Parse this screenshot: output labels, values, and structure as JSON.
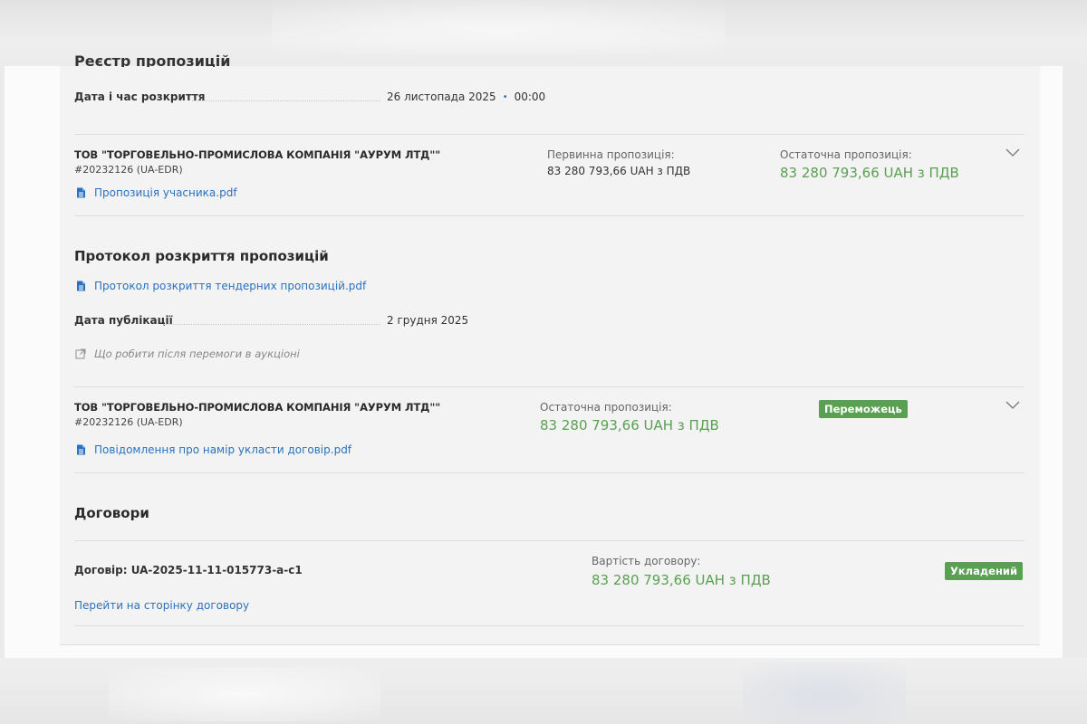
{
  "bids_registry": {
    "heading": "Реєстр пропозицій",
    "opening_label": "Дата і час розкриття",
    "opening_date": "26 листопада 2025",
    "opening_separator": "•",
    "opening_time": "00:00"
  },
  "bid": {
    "company": "ТОВ \"ТОРГОВЕЛЬНО-ПРОМИСЛОВА КОМПАНІЯ \"АУРУМ ЛТД\"\"",
    "edr": "#20232126 (UA-EDR)",
    "document": "Пропозиція учасника.pdf",
    "initial_label": "Первинна пропозиція:",
    "initial_value": "83 280 793,66 UAH з ПДВ",
    "final_label": "Остаточна пропозиція:",
    "final_value": "83 280 793,66 UAH з ПДВ"
  },
  "protocol": {
    "title": "Протокол розкриття пропозицій",
    "document": "Протокол розкриття тендерних пропозицій.pdf",
    "publication_label": "Дата публікації",
    "publication_date": "2 грудня 2025",
    "help_link": "Що робити після перемоги в аукціоні"
  },
  "winner": {
    "company": "ТОВ \"ТОРГОВЕЛЬНО-ПРОМИСЛОВА КОМПАНІЯ \"АУРУМ ЛТД\"\"",
    "edr": "#20232126 (UA-EDR)",
    "document": "Повідомлення про намір укласти договір.pdf",
    "final_label": "Остаточна пропозиція:",
    "final_value": "83 280 793,66 UAH з ПДВ",
    "badge": "Переможець"
  },
  "contracts": {
    "title": "Договори",
    "contract_label": "Договір: UA-2025-11-11-015773-a-c1",
    "value_label": "Вартість договору:",
    "value": "83 280 793,66 UAH з ПДВ",
    "status": "Укладений",
    "link": "Перейти на сторінку договору"
  },
  "colors": {
    "link": "#2a72bd",
    "green": "#5aa052",
    "panel": "#f3f3f3"
  },
  "icons": [
    "document-icon",
    "external-link-icon",
    "chevron-down-icon"
  ]
}
